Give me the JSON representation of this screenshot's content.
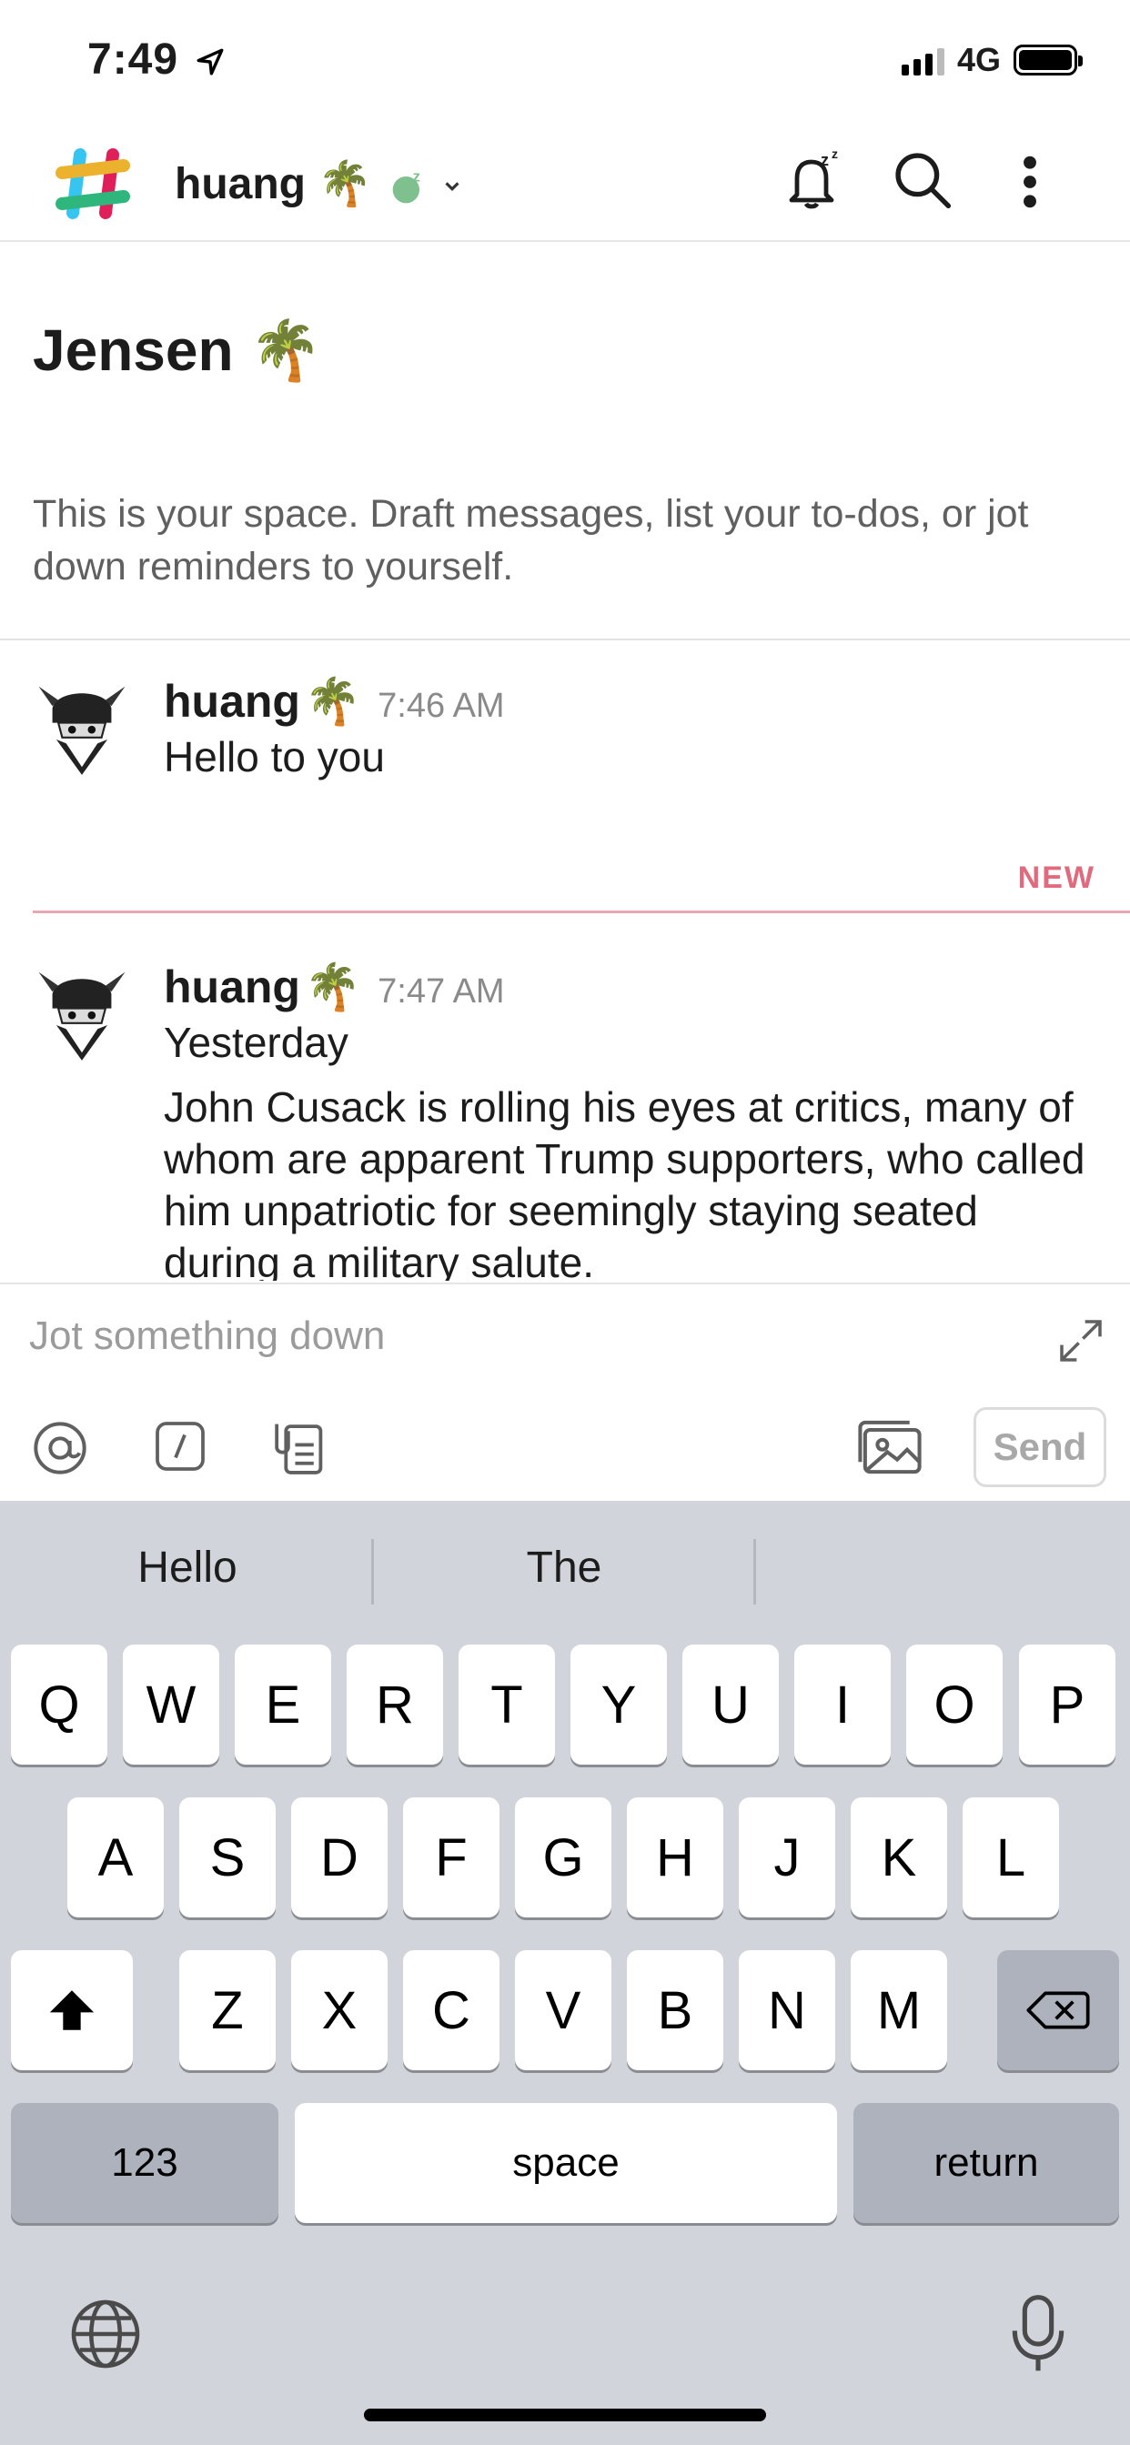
{
  "status_bar": {
    "time": "7:49",
    "network": "4G"
  },
  "header": {
    "workspace": "huang",
    "workspace_emoji": "🌴"
  },
  "channel": {
    "title": "Jensen",
    "title_emoji": "🌴",
    "description": "This is your space. Draft messages, list your to-dos, or jot down reminders to yourself."
  },
  "messages": [
    {
      "author": "huang",
      "emoji": "🌴",
      "time": "7:46 AM",
      "lines": [
        "Hello to you"
      ]
    },
    {
      "author": "huang",
      "emoji": "🌴",
      "time": "7:47 AM",
      "lines": [
        "Yesterday",
        "John Cusack is rolling his eyes at critics, many of whom are apparent Trump supporters, who called him unpatriotic for seemingly staying seated during a military salute."
      ]
    }
  ],
  "new_divider_label": "NEW",
  "composer": {
    "placeholder": "Jot something down",
    "send_label": "Send"
  },
  "keyboard": {
    "suggestions": [
      "Hello",
      "The",
      ""
    ],
    "row1": [
      "Q",
      "W",
      "E",
      "R",
      "T",
      "Y",
      "U",
      "I",
      "O",
      "P"
    ],
    "row2": [
      "A",
      "S",
      "D",
      "F",
      "G",
      "H",
      "J",
      "K",
      "L"
    ],
    "row3": [
      "Z",
      "X",
      "C",
      "V",
      "B",
      "N",
      "M"
    ],
    "numbers_label": "123",
    "space_label": "space",
    "return_label": "return"
  },
  "colors": {
    "new_accent": "#e06b7e",
    "keyboard_bg": "#d1d4da",
    "status_away": "#7fc08f"
  }
}
